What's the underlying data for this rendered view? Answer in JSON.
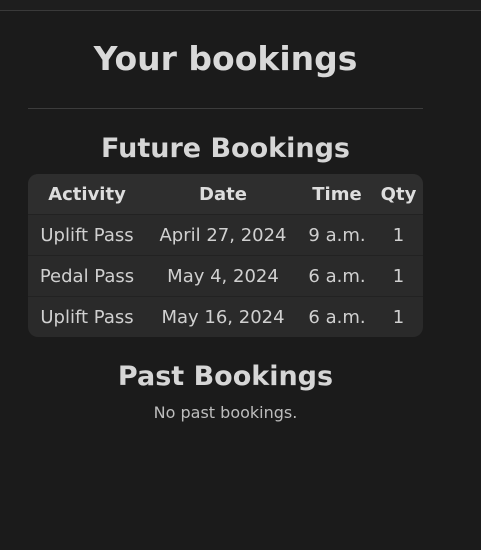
{
  "page": {
    "title": "Your bookings"
  },
  "future": {
    "heading": "Future Bookings",
    "columns": {
      "activity": "Activity",
      "date": "Date",
      "time": "Time",
      "qty": "Qty"
    },
    "rows": [
      {
        "activity": "Uplift Pass",
        "date": "April 27, 2024",
        "time": "9 a.m.",
        "qty": "1"
      },
      {
        "activity": "Pedal Pass",
        "date": "May 4, 2024",
        "time": "6 a.m.",
        "qty": "1"
      },
      {
        "activity": "Uplift Pass",
        "date": "May 16, 2024",
        "time": "6 a.m.",
        "qty": "1"
      }
    ]
  },
  "past": {
    "heading": "Past Bookings",
    "empty_text": "No past bookings."
  }
}
